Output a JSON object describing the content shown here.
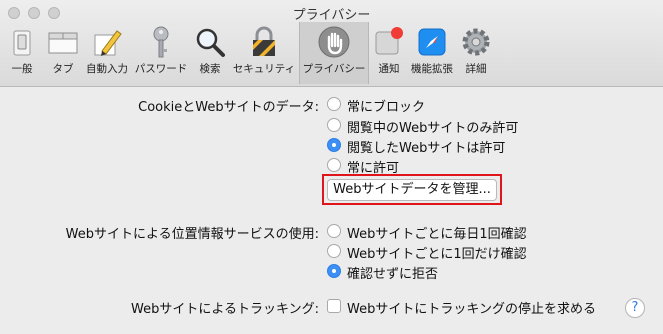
{
  "window": {
    "title": "プライバシー"
  },
  "toolbar": {
    "items": [
      {
        "label": "一般",
        "icon": "switch-icon"
      },
      {
        "label": "タブ",
        "icon": "tabs-icon"
      },
      {
        "label": "自動入力",
        "icon": "pencil-icon"
      },
      {
        "label": "パスワード",
        "icon": "key-icon"
      },
      {
        "label": "検索",
        "icon": "magnifier-icon"
      },
      {
        "label": "セキュリティ",
        "icon": "lock-icon"
      },
      {
        "label": "プライバシー",
        "icon": "hand-icon",
        "active": true
      },
      {
        "label": "通知",
        "icon": "notification-icon"
      },
      {
        "label": "機能拡張",
        "icon": "compass-icon"
      },
      {
        "label": "詳細",
        "icon": "gear-icon"
      }
    ]
  },
  "cookies": {
    "label": "CookieとWebサイトのデータ:",
    "options": [
      {
        "text": "常にブロック",
        "selected": false
      },
      {
        "text": "閲覧中のWebサイトのみ許可",
        "selected": false
      },
      {
        "text": "閲覧したWebサイトは許可",
        "selected": true
      },
      {
        "text": "常に許可",
        "selected": false
      }
    ],
    "manage_button": "Webサイトデータを管理..."
  },
  "location": {
    "label": "Webサイトによる位置情報サービスの使用:",
    "options": [
      {
        "text": "Webサイトごとに毎日1回確認",
        "selected": false
      },
      {
        "text": "Webサイトごとに1回だけ確認",
        "selected": false
      },
      {
        "text": "確認せずに拒否",
        "selected": true
      }
    ]
  },
  "tracking": {
    "label": "Webサイトによるトラッキング:",
    "checkbox_text": "Webサイトにトラッキングの停止を求める",
    "checked": false
  },
  "help": {
    "label": "?"
  },
  "colors": {
    "accent": "#3b8ff5",
    "highlight": "#e0141b",
    "badge": "#f03b36"
  }
}
